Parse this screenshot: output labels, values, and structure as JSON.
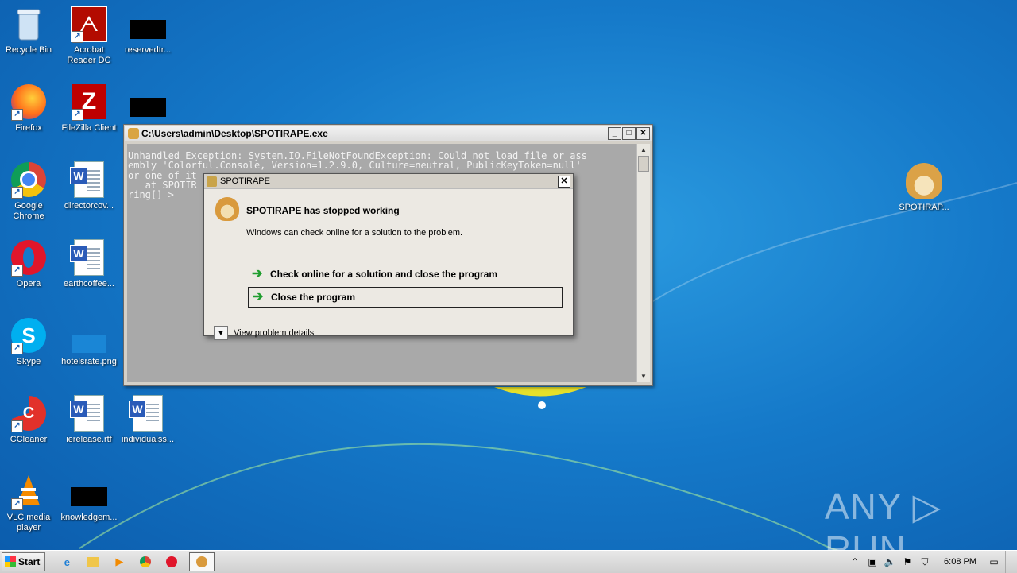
{
  "desktop_icons": [
    {
      "label": "Recycle Bin",
      "icon": "recycle-bin-icon"
    },
    {
      "label": "Acrobat Reader DC",
      "icon": "acrobat-reader-icon"
    },
    {
      "label": "reservedtr...",
      "icon": "image-thumbnail-icon"
    },
    {
      "label": "Firefox",
      "icon": "firefox-icon"
    },
    {
      "label": "FileZilla Client",
      "icon": "filezilla-icon"
    },
    {
      "label": "",
      "icon": "image-thumbnail-icon"
    },
    {
      "label": "Google Chrome",
      "icon": "chrome-icon"
    },
    {
      "label": "directorcov...",
      "icon": "word-document-icon"
    },
    {
      "label": "Opera",
      "icon": "opera-icon"
    },
    {
      "label": "earthcoffee...",
      "icon": "word-document-icon"
    },
    {
      "label": "Skype",
      "icon": "skype-icon"
    },
    {
      "label": "hotelsrate.png",
      "icon": "image-file-icon"
    },
    {
      "label": "CCleaner",
      "icon": "ccleaner-icon"
    },
    {
      "label": "ierelease.rtf",
      "icon": "word-document-icon"
    },
    {
      "label": "individualss...",
      "icon": "word-document-icon"
    },
    {
      "label": "VLC media player",
      "icon": "vlc-icon"
    },
    {
      "label": "knowledgem...",
      "icon": "image-thumbnail-icon"
    },
    {
      "label": "SPOTIRAP...",
      "icon": "doge-icon"
    }
  ],
  "console": {
    "title": "C:\\Users\\admin\\Desktop\\SPOTIRAPE.exe",
    "text": "Unhandled Exception: System.IO.FileNotFoundException: Could not load file or ass\nembly 'Colorful.Console, Version=1.2.9.0, Culture=neutral, PublicKeyToken=null'\nor one of it                                                                    \n   at SPOTIR                                                       ??????<St\nring[] >",
    "minimize": "_",
    "maximize": "□",
    "close": "✕"
  },
  "dialog": {
    "title": "SPOTIRAPE",
    "close": "✕",
    "headline": "SPOTIRAPE has stopped working",
    "subline": "Windows can check online for a solution to the problem.",
    "option_online": "Check online for a solution and close the program",
    "option_close": "Close the program",
    "details": "View problem details"
  },
  "watermark": "ANY ▷ RUN",
  "taskbar": {
    "start": "Start",
    "clock": "6:08 PM",
    "items": [
      "ie-icon",
      "explorer-icon",
      "media-player-icon",
      "chrome-icon",
      "opera-icon",
      "doge-app-icon"
    ]
  },
  "colors": {
    "desktop": "#1579c9",
    "accent_green": "#1f9d2e",
    "console_bg": "#a9a9a9"
  }
}
